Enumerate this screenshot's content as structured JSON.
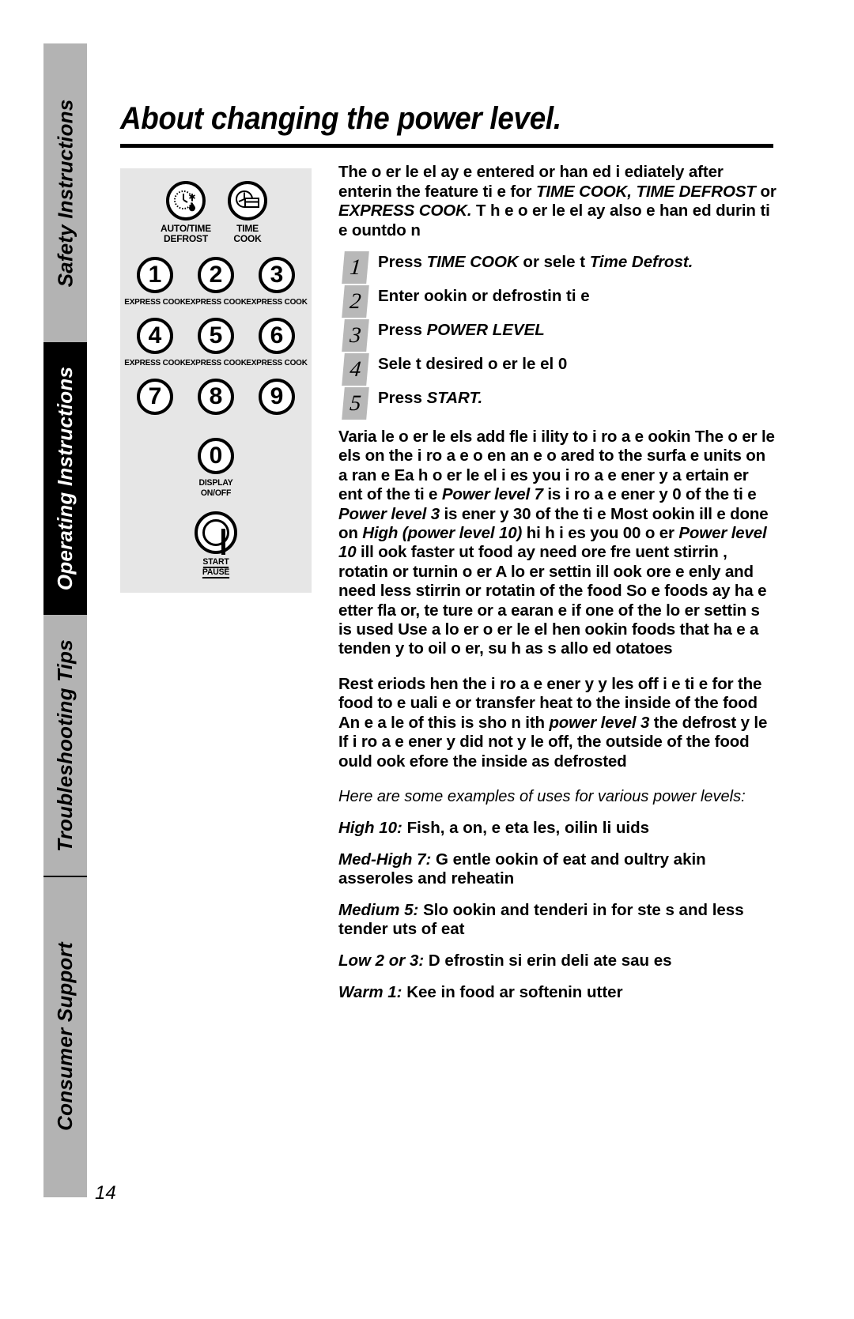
{
  "document": {
    "page_number": "14",
    "title": "About changing the power level."
  },
  "sidebar": {
    "tabs": [
      {
        "label": "Safety Instructions",
        "style": "gray"
      },
      {
        "label": "Operating Instructions",
        "style": "black"
      },
      {
        "label": "Troubleshooting Tips",
        "style": "gray"
      },
      {
        "label": "Consumer Support",
        "style": "gray"
      }
    ]
  },
  "control_panel": {
    "feature_buttons": [
      {
        "icon": "clock-snowflake-defrost-icon",
        "caption_line1": "AUTO/TIME",
        "caption_line2": "DEFROST"
      },
      {
        "icon": "clock-dish-timecook-icon",
        "caption_line1": "TIME",
        "caption_line2": "COOK"
      }
    ],
    "number_buttons": [
      {
        "digit": "1",
        "caption": "EXPRESS COOK"
      },
      {
        "digit": "2",
        "caption": "EXPRESS COOK"
      },
      {
        "digit": "3",
        "caption": "EXPRESS COOK"
      },
      {
        "digit": "4",
        "caption": "EXPRESS COOK"
      },
      {
        "digit": "5",
        "caption": "EXPRESS COOK"
      },
      {
        "digit": "6",
        "caption": "EXPRESS COOK"
      },
      {
        "digit": "7",
        "caption": ""
      },
      {
        "digit": "8",
        "caption": ""
      },
      {
        "digit": "9",
        "caption": ""
      }
    ],
    "zero_button": {
      "digit": "0",
      "caption_line1": "DISPLAY",
      "caption_line2": "ON/OFF"
    },
    "start_button": {
      "icon": "power-start-icon",
      "caption_line1": "START",
      "caption_line2": "PAUSE"
    }
  },
  "main": {
    "intro": {
      "seg1": "The  o er le el   ay  e entered or  han ed i    ediately after enterin  the feature ti  e for ",
      "em1": "TIME COOK, TIME DEFROST",
      "seg2": " or ",
      "em2": "EXPRESS COOK.",
      "seg3": " T h e   o er le el   ay also  e han ed durin  ti  e ountdo n"
    },
    "steps": [
      {
        "number": "1",
        "seg1": "Press ",
        "em1": "TIME COOK",
        "seg2": " or sele t ",
        "em2": "Time Defrost.",
        "seg3": ""
      },
      {
        "number": "2",
        "seg1": "Enter  ookin  or defrostin  ti  e",
        "em1": "",
        "seg2": "",
        "em2": "",
        "seg3": ""
      },
      {
        "number": "3",
        "seg1": "Press ",
        "em1": "POWER LEVEL",
        "seg2": "",
        "em2": "",
        "seg3": ""
      },
      {
        "number": "4",
        "seg1": "Sele t desired   o er le el     0",
        "em1": "",
        "seg2": "",
        "em2": "",
        "seg3": ""
      },
      {
        "number": "5",
        "seg1": "Press ",
        "em1": "START.",
        "seg2": "",
        "em2": "",
        "seg3": ""
      }
    ],
    "body_paragraph_1": {
      "p1": "Varia le  o er le els add fle i ility to   i ro a e  ookin  The  o er le els on the  i ro a e o en an  e o   ared to the surfa e units on a ran e Ea h  o er le el  i es you  i ro a e ener y a  ertain  er ent of the ti  e ",
      "em1": "Power level 7",
      "p2": " is  i ro a e ener y  0   of the ti  e ",
      "em2": "Power level 3",
      "p3": " is ener y 30   of the ti  e Most  ookin   ill  e done on ",
      "em3": "High (power level 10)",
      "p4": "  hi h  i es you  00   o er ",
      "em4": "Power level 10",
      "p5": "  ill  ook faster  ut food   ay need   ore fre uent stirrin , rotatin  or turnin  o er A lo er settin   ill  ook  ore e enly and need less stirrin  or rotatin  of the food So  e foods  ay ha e  etter fla or, te ture or a  earan e if one of the lo er settin s is used  Use a lo er  o er le el  hen  ookin  foods that ha e a tenden y to  oil o er, su h as s allo ed  otatoes"
    },
    "body_paragraph_2": {
      "p1": "Rest  eriods  hen the  i ro a e ener y  y les off  i e ti  e for the food to  e uali e  or transfer heat to the inside of the food  An e a   le of this is sho n  ith ",
      "em1": "power level 3",
      "p2": "  the defrost  y le If  i ro a e ener y did not  y le off, the outside of the food  ould  ook  efore the inside   as defrosted"
    },
    "examples_intro": "Here are some examples of uses for various power levels:",
    "examples": [
      {
        "label": "High 10:",
        "text": " Fish,  a on,  e eta les,  oilin  li uids"
      },
      {
        "label": "Med-High 7:",
        "text": " G entle  ookin  of   eat and   oultry  akin   asseroles and  reheatin "
      },
      {
        "label": "Medium 5:",
        "text": " Slo    ookin  and tenderi in  for ste s and less tender  uts of   eat"
      },
      {
        "label": "Low 2 or 3:",
        "text": " D efrostin  si   erin   deli ate sau es"
      },
      {
        "label": "Warm 1:",
        "text": " Kee in  food  ar   softenin   utter"
      }
    ]
  }
}
